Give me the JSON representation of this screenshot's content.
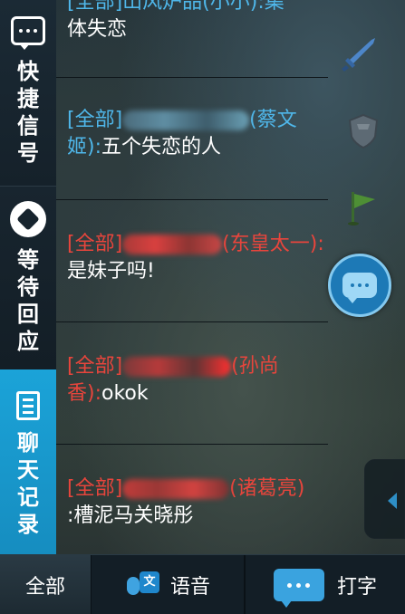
{
  "sidebar": {
    "quick_signal": [
      "快",
      "捷",
      "信",
      "号"
    ],
    "wait_respond": [
      "等",
      "待",
      "回",
      "应"
    ],
    "chat_history": [
      "聊",
      "天",
      "记",
      "录"
    ]
  },
  "messages": [
    {
      "tag": "",
      "nick": "",
      "text": "体失恋",
      "partial_top": "[全部]山风炉品(小小):集"
    },
    {
      "tag": "[全部]",
      "nick": "(蔡文姬):",
      "text": "五个失恋的人"
    },
    {
      "tag": "[全部]",
      "nick": "(东皇太一):",
      "text": "是妹子吗!"
    },
    {
      "tag": "[全部]",
      "nick": "(孙尚香):",
      "text": "okok"
    },
    {
      "tag": "[全部]",
      "nick": "(诸葛亮)",
      "text": ":槽泥马关晓彤"
    }
  ],
  "bottom_bar": {
    "all_label": "全部",
    "voice_label": "语音",
    "voice_icon_char": "文",
    "type_label": "打字"
  },
  "colors": {
    "accent_blue": "#4fb7ea",
    "accent_red": "#e8453c",
    "sidebar_active": "#1ba3d8"
  }
}
